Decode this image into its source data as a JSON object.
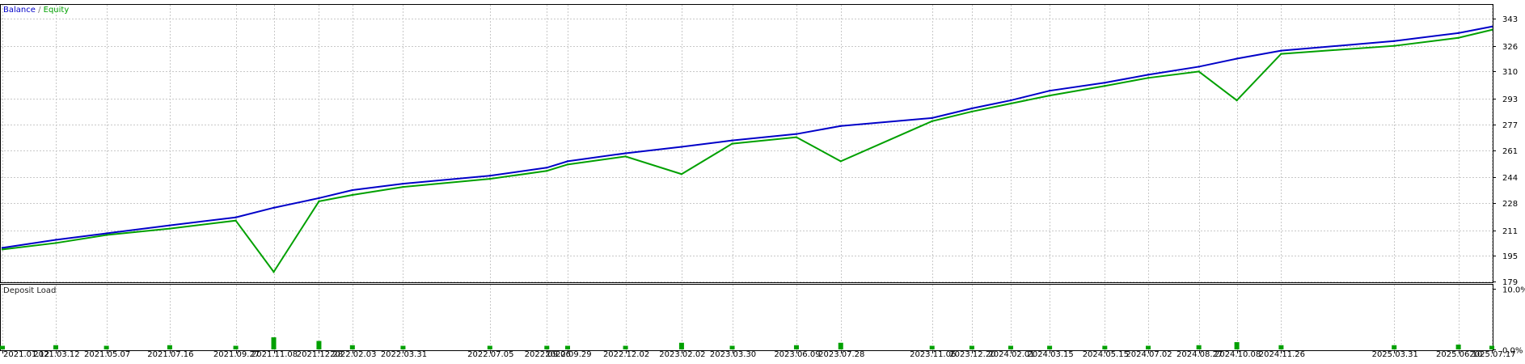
{
  "chart_data": [
    {
      "type": "line",
      "legend_position": "top-left",
      "grid": true,
      "series": [
        {
          "name": "Balance",
          "color": "#0000c8",
          "points": [
            [
              "2021.01.12",
              200
            ],
            [
              "2021.03.12",
              205
            ],
            [
              "2021.05.07",
              209
            ],
            [
              "2021.07.16",
              214
            ],
            [
              "2021.09.27",
              219
            ],
            [
              "2021.11.08",
              225
            ],
            [
              "2021.12.28",
              231
            ],
            [
              "2022.02.03",
              236
            ],
            [
              "2022.03.31",
              240
            ],
            [
              "2022.07.05",
              245
            ],
            [
              "2022.09.06",
              250
            ],
            [
              "2022.09.29",
              254
            ],
            [
              "2022.12.02",
              259
            ],
            [
              "2023.02.02",
              263
            ],
            [
              "2023.03.30",
              267
            ],
            [
              "2023.06.09",
              271
            ],
            [
              "2023.07.28",
              276
            ],
            [
              "2023.11.06",
              281
            ],
            [
              "2023.12.20",
              287
            ],
            [
              "2024.02.01",
              292
            ],
            [
              "2024.03.15",
              298
            ],
            [
              "2024.05.15",
              303
            ],
            [
              "2024.07.02",
              308
            ],
            [
              "2024.08.27",
              313
            ],
            [
              "2024.10.08",
              318
            ],
            [
              "2024.11.26",
              323
            ],
            [
              "2025.03.31",
              329
            ],
            [
              "2025.06.10",
              334
            ],
            [
              "2025.07.17",
              338
            ]
          ]
        },
        {
          "name": "Equity",
          "color": "#00a000",
          "points": [
            [
              "2021.01.12",
              199
            ],
            [
              "2021.03.12",
              203
            ],
            [
              "2021.05.07",
              208
            ],
            [
              "2021.07.16",
              212
            ],
            [
              "2021.09.27",
              217
            ],
            [
              "2021.11.08",
              185
            ],
            [
              "2021.12.28",
              229
            ],
            [
              "2022.02.03",
              233
            ],
            [
              "2022.03.31",
              238
            ],
            [
              "2022.07.05",
              243
            ],
            [
              "2022.09.06",
              248
            ],
            [
              "2022.09.29",
              252
            ],
            [
              "2022.12.02",
              257
            ],
            [
              "2023.02.02",
              246
            ],
            [
              "2023.03.30",
              265
            ],
            [
              "2023.06.09",
              269
            ],
            [
              "2023.07.28",
              254
            ],
            [
              "2023.11.06",
              279
            ],
            [
              "2023.12.20",
              285
            ],
            [
              "2024.02.01",
              290
            ],
            [
              "2024.03.15",
              295
            ],
            [
              "2024.05.15",
              301
            ],
            [
              "2024.07.02",
              306
            ],
            [
              "2024.08.27",
              310
            ],
            [
              "2024.10.08",
              292
            ],
            [
              "2024.11.26",
              321
            ],
            [
              "2025.03.31",
              326
            ],
            [
              "2025.06.10",
              331
            ],
            [
              "2025.07.17",
              336
            ]
          ]
        }
      ],
      "y_ticks": [
        343,
        326,
        310,
        293,
        277,
        261,
        244,
        228,
        211,
        195,
        179
      ],
      "ylim": [
        179,
        343
      ],
      "legend": {
        "balance": "Balance",
        "separator": " / ",
        "equity": "Equity"
      }
    },
    {
      "type": "bar",
      "title": "Deposit Load",
      "color": "#00a000",
      "x": [
        "2021.01.12",
        "2021.03.12",
        "2021.05.07",
        "2021.07.16",
        "2021.09.27",
        "2021.11.08",
        "2021.12.28",
        "2022.02.03",
        "2022.03.31",
        "2022.07.05",
        "2022.09.06",
        "2022.09.29",
        "2022.12.02",
        "2023.02.02",
        "2023.03.30",
        "2023.06.09",
        "2023.07.28",
        "2023.11.06",
        "2023.12.20",
        "2024.02.01",
        "2024.03.15",
        "2024.05.15",
        "2024.07.02",
        "2024.08.27",
        "2024.10.08",
        "2024.11.26",
        "2025.03.31",
        "2025.06.10",
        "2025.07.17"
      ],
      "values": [
        0.6,
        0.7,
        0.6,
        0.7,
        0.6,
        2.0,
        1.4,
        0.7,
        0.6,
        0.6,
        0.6,
        0.6,
        0.6,
        1.1,
        0.6,
        0.7,
        1.1,
        0.6,
        0.6,
        0.6,
        0.6,
        0.6,
        0.6,
        0.7,
        1.2,
        0.7,
        0.7,
        0.8,
        0.6
      ],
      "y_ticks": [
        "10.0%",
        "0.0%"
      ],
      "ylim": [
        0,
        10
      ]
    }
  ],
  "axis": {
    "x_ticks": [
      "2021.01.12",
      "2021.03.12",
      "2021.05.07",
      "2021.07.16",
      "2021.09.27",
      "2021.11.08",
      "2021.12.28",
      "2022.02.03",
      "2022.03.31",
      "2022.07.05",
      "2022.09.06",
      "2022.09.29",
      "2022.12.02",
      "2023.02.02",
      "2023.03.30",
      "2023.06.09",
      "2023.07.28",
      "2023.11.06",
      "2023.12.20",
      "2024.02.01",
      "2024.03.15",
      "2024.05.15",
      "2024.07.02",
      "2024.08.27",
      "2024.10.08",
      "2024.11.26",
      "2025.03.31",
      "2025.06.10",
      "2025.07.17"
    ]
  }
}
